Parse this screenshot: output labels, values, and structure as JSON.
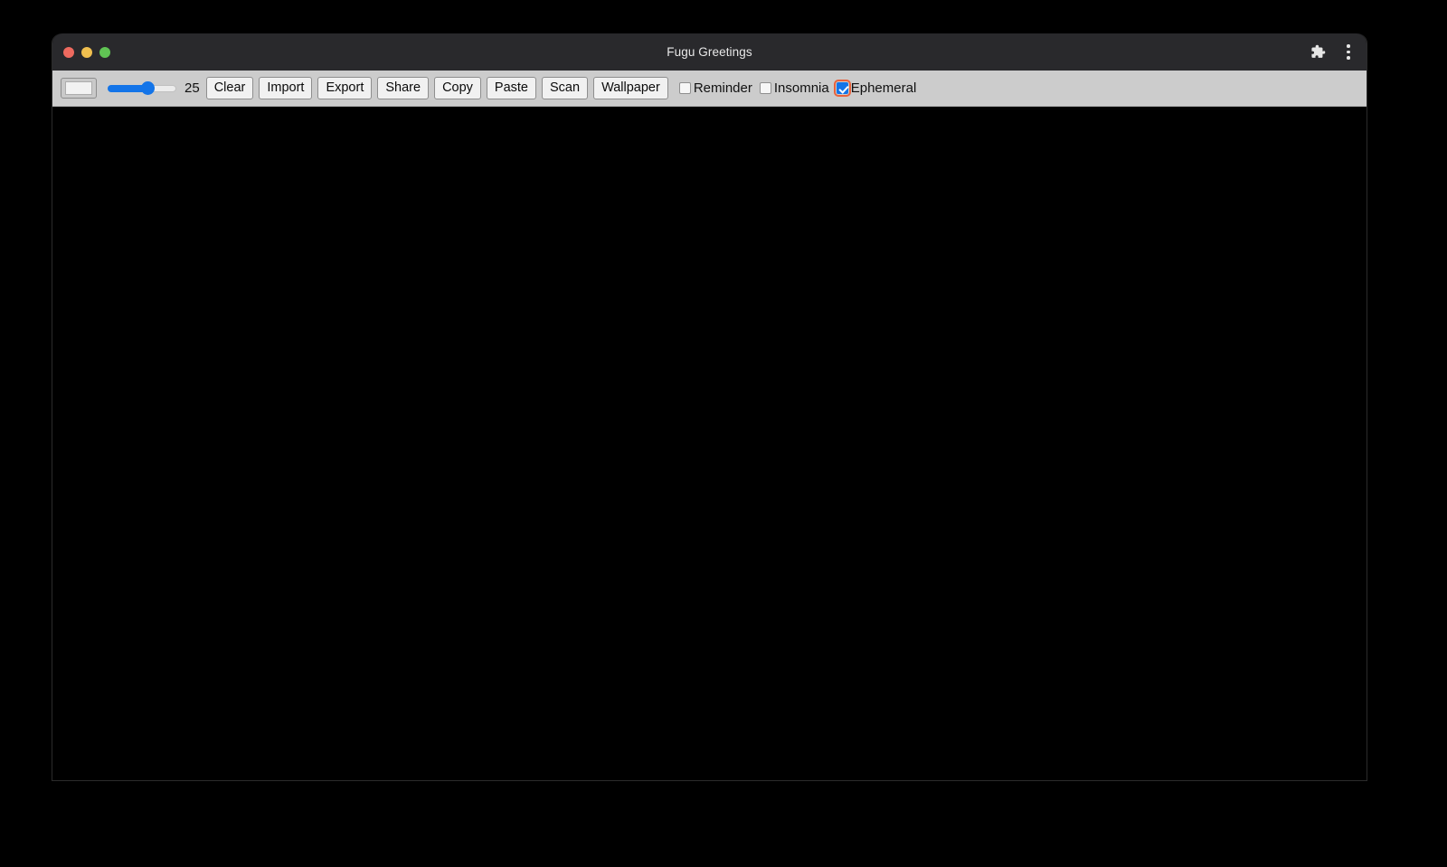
{
  "window": {
    "title": "Fugu Greetings",
    "traffic_lights": [
      {
        "name": "close",
        "color": "#ee6a5f"
      },
      {
        "name": "minimize",
        "color": "#f0bf4f"
      },
      {
        "name": "maximize",
        "color": "#60c454"
      }
    ],
    "titlebar_icons": [
      {
        "name": "extensions-icon",
        "glyph": "puzzle"
      },
      {
        "name": "browser-menu-icon",
        "glyph": "kebab"
      }
    ]
  },
  "toolbar": {
    "color_picker": {
      "label": "color-picker",
      "value": "#f2f2f2"
    },
    "slider": {
      "label": "line-width-slider",
      "value": "25",
      "min": "1",
      "max": "50",
      "percent": 55
    },
    "buttons": [
      {
        "label": "Clear",
        "name": "clear-button"
      },
      {
        "label": "Import",
        "name": "import-button"
      },
      {
        "label": "Export",
        "name": "export-button"
      },
      {
        "label": "Share",
        "name": "share-button"
      },
      {
        "label": "Copy",
        "name": "copy-button"
      },
      {
        "label": "Paste",
        "name": "paste-button"
      },
      {
        "label": "Scan",
        "name": "scan-button"
      },
      {
        "label": "Wallpaper",
        "name": "wallpaper-button"
      }
    ],
    "checkboxes": [
      {
        "label": "Reminder",
        "name": "reminder-checkbox",
        "checked": false,
        "focused": false
      },
      {
        "label": "Insomnia",
        "name": "insomnia-checkbox",
        "checked": false,
        "focused": false
      },
      {
        "label": "Ephemeral",
        "name": "ephemeral-checkbox",
        "checked": true,
        "focused": true
      }
    ]
  },
  "canvas": {
    "name": "drawing-canvas",
    "background": "#000000"
  },
  "colors": {
    "accent": "#1374e8",
    "focus_ring": "#e8623c",
    "toolbar_bg": "#cccccc",
    "titlebar_bg": "#29292c",
    "desktop_bg": "#000000"
  }
}
